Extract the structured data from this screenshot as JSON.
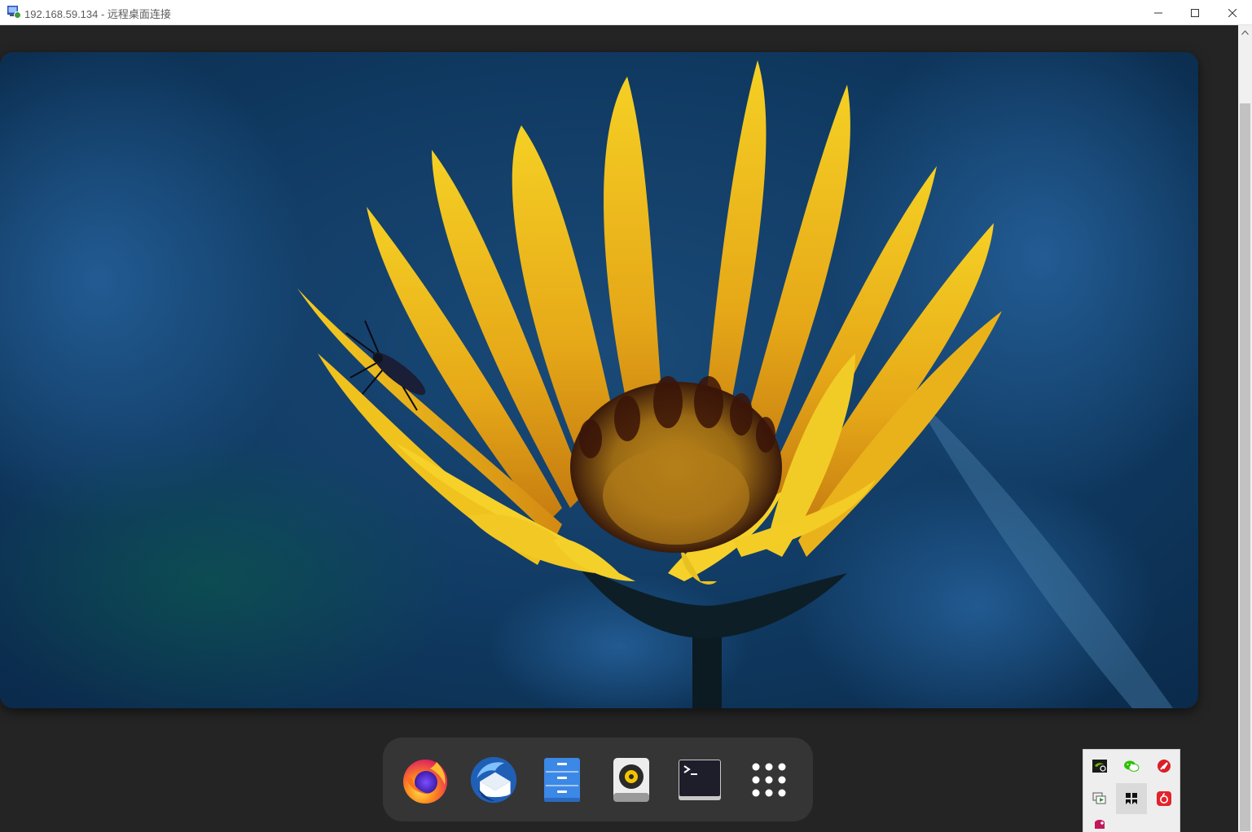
{
  "window": {
    "title": "192.168.59.134 - 远程桌面连接",
    "app_icon": "remote-desktop-icon",
    "controls": {
      "minimize": "minimize-icon",
      "maximize": "maximize-icon",
      "close": "close-icon"
    }
  },
  "desktop": {
    "wallpaper": "yellow-flower-with-insect",
    "colors": {
      "background": "#242424",
      "dock": "#353535",
      "petal": "#e8b21a",
      "sky": "#0f3a66"
    }
  },
  "dock": {
    "items": [
      {
        "icon": "firefox-icon"
      },
      {
        "icon": "thunderbird-icon"
      },
      {
        "icon": "files-icon"
      },
      {
        "icon": "rhythmbox-icon"
      },
      {
        "icon": "terminal-icon"
      },
      {
        "icon": "show-apps-icon"
      }
    ]
  },
  "tray": {
    "icons": [
      {
        "icon": "nvidia-icon"
      },
      {
        "icon": "wechat-icon"
      },
      {
        "icon": "no-entry-icon"
      },
      {
        "icon": "screen-share-icon"
      },
      {
        "icon": "app-launcher-icon",
        "active": true
      },
      {
        "icon": "netease-music-icon"
      },
      {
        "icon": "gamepad-icon"
      }
    ]
  }
}
